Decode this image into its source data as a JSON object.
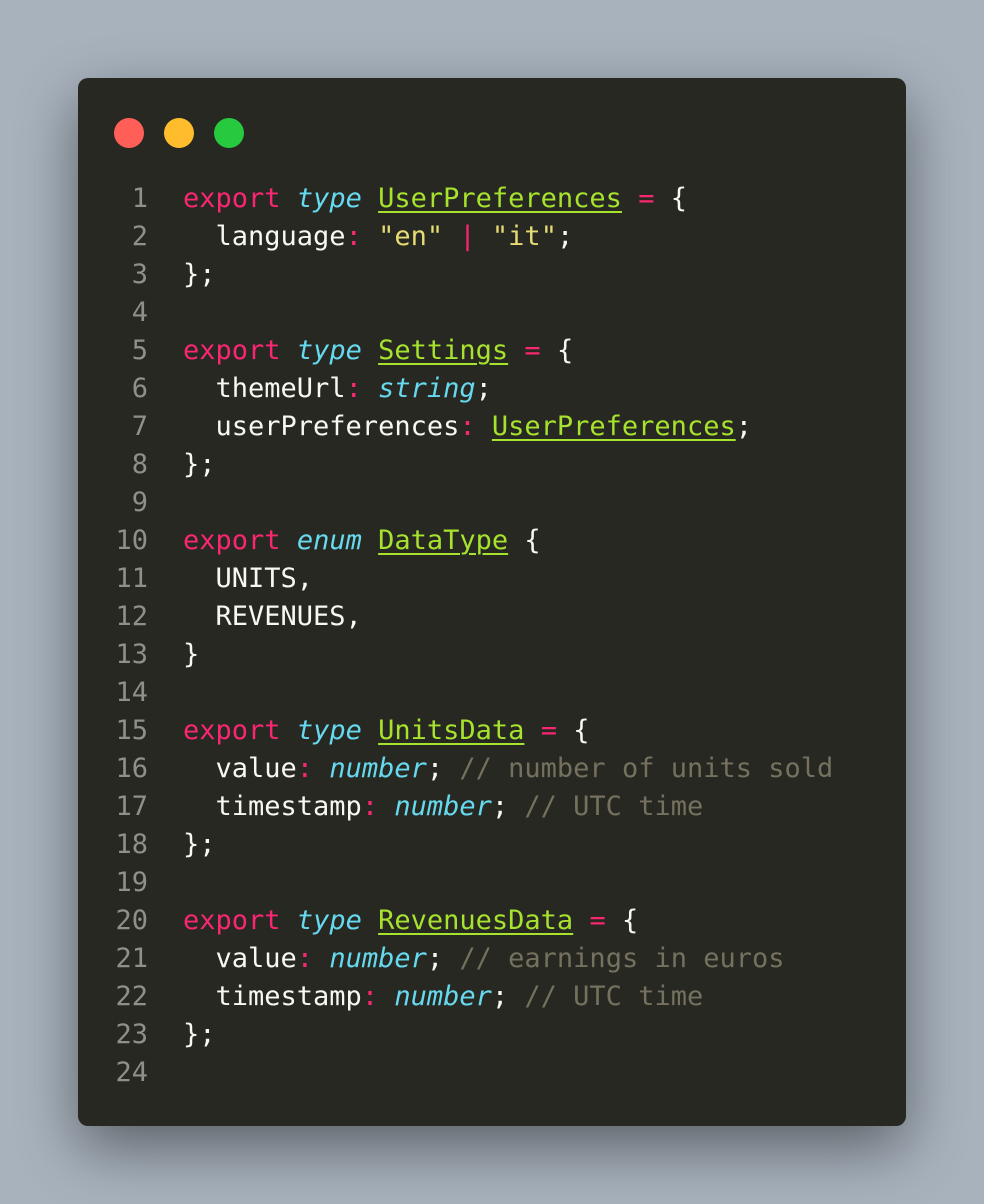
{
  "window": {
    "buttons": {
      "close_color": "#ff5f56",
      "minimize_color": "#ffbd2e",
      "maximize_color": "#27c93f"
    }
  },
  "editor": {
    "language": "TypeScript",
    "theme_colors": {
      "background": "#272822",
      "keyword": "#f92672",
      "storage": "#66d9ef",
      "type": "#a6e22e",
      "string": "#e6db74",
      "comment": "#75715e",
      "text": "#f8f8f2",
      "line_number": "#8f908a"
    },
    "lines": [
      {
        "n": "1",
        "tokens": [
          {
            "t": "export",
            "k": "keyword"
          },
          {
            "t": " ",
            "k": "text"
          },
          {
            "t": "type",
            "k": "storage"
          },
          {
            "t": " ",
            "k": "text"
          },
          {
            "t": "UserPreferences",
            "k": "type"
          },
          {
            "t": " ",
            "k": "text"
          },
          {
            "t": "=",
            "k": "operator"
          },
          {
            "t": " {",
            "k": "punct"
          }
        ]
      },
      {
        "n": "2",
        "tokens": [
          {
            "t": "  language",
            "k": "prop"
          },
          {
            "t": ":",
            "k": "operator"
          },
          {
            "t": " ",
            "k": "text"
          },
          {
            "t": "\"en\"",
            "k": "string"
          },
          {
            "t": " ",
            "k": "text"
          },
          {
            "t": "|",
            "k": "operator"
          },
          {
            "t": " ",
            "k": "text"
          },
          {
            "t": "\"it\"",
            "k": "string"
          },
          {
            "t": ";",
            "k": "punct"
          }
        ]
      },
      {
        "n": "3",
        "tokens": [
          {
            "t": "};",
            "k": "punct"
          }
        ]
      },
      {
        "n": "4",
        "tokens": []
      },
      {
        "n": "5",
        "tokens": [
          {
            "t": "export",
            "k": "keyword"
          },
          {
            "t": " ",
            "k": "text"
          },
          {
            "t": "type",
            "k": "storage"
          },
          {
            "t": " ",
            "k": "text"
          },
          {
            "t": "Settings",
            "k": "type"
          },
          {
            "t": " ",
            "k": "text"
          },
          {
            "t": "=",
            "k": "operator"
          },
          {
            "t": " {",
            "k": "punct"
          }
        ]
      },
      {
        "n": "6",
        "tokens": [
          {
            "t": "  themeUrl",
            "k": "prop"
          },
          {
            "t": ":",
            "k": "operator"
          },
          {
            "t": " ",
            "k": "text"
          },
          {
            "t": "string",
            "k": "storage"
          },
          {
            "t": ";",
            "k": "punct"
          }
        ]
      },
      {
        "n": "7",
        "tokens": [
          {
            "t": "  userPreferences",
            "k": "prop"
          },
          {
            "t": ":",
            "k": "operator"
          },
          {
            "t": " ",
            "k": "text"
          },
          {
            "t": "UserPreferences",
            "k": "type"
          },
          {
            "t": ";",
            "k": "punct"
          }
        ]
      },
      {
        "n": "8",
        "tokens": [
          {
            "t": "};",
            "k": "punct"
          }
        ]
      },
      {
        "n": "9",
        "tokens": []
      },
      {
        "n": "10",
        "tokens": [
          {
            "t": "export",
            "k": "keyword"
          },
          {
            "t": " ",
            "k": "text"
          },
          {
            "t": "enum",
            "k": "storage"
          },
          {
            "t": " ",
            "k": "text"
          },
          {
            "t": "DataType",
            "k": "type"
          },
          {
            "t": " {",
            "k": "punct"
          }
        ]
      },
      {
        "n": "11",
        "tokens": [
          {
            "t": "  UNITS,",
            "k": "text"
          }
        ]
      },
      {
        "n": "12",
        "tokens": [
          {
            "t": "  REVENUES,",
            "k": "text"
          }
        ]
      },
      {
        "n": "13",
        "tokens": [
          {
            "t": "}",
            "k": "punct"
          }
        ]
      },
      {
        "n": "14",
        "tokens": []
      },
      {
        "n": "15",
        "tokens": [
          {
            "t": "export",
            "k": "keyword"
          },
          {
            "t": " ",
            "k": "text"
          },
          {
            "t": "type",
            "k": "storage"
          },
          {
            "t": " ",
            "k": "text"
          },
          {
            "t": "UnitsData",
            "k": "type"
          },
          {
            "t": " ",
            "k": "text"
          },
          {
            "t": "=",
            "k": "operator"
          },
          {
            "t": " {",
            "k": "punct"
          }
        ]
      },
      {
        "n": "16",
        "tokens": [
          {
            "t": "  value",
            "k": "prop"
          },
          {
            "t": ":",
            "k": "operator"
          },
          {
            "t": " ",
            "k": "text"
          },
          {
            "t": "number",
            "k": "storage"
          },
          {
            "t": "; ",
            "k": "punct"
          },
          {
            "t": "// number of units sold",
            "k": "comment"
          }
        ]
      },
      {
        "n": "17",
        "tokens": [
          {
            "t": "  timestamp",
            "k": "prop"
          },
          {
            "t": ":",
            "k": "operator"
          },
          {
            "t": " ",
            "k": "text"
          },
          {
            "t": "number",
            "k": "storage"
          },
          {
            "t": "; ",
            "k": "punct"
          },
          {
            "t": "// UTC time",
            "k": "comment"
          }
        ]
      },
      {
        "n": "18",
        "tokens": [
          {
            "t": "};",
            "k": "punct"
          }
        ]
      },
      {
        "n": "19",
        "tokens": []
      },
      {
        "n": "20",
        "tokens": [
          {
            "t": "export",
            "k": "keyword"
          },
          {
            "t": " ",
            "k": "text"
          },
          {
            "t": "type",
            "k": "storage"
          },
          {
            "t": " ",
            "k": "text"
          },
          {
            "t": "RevenuesData",
            "k": "type"
          },
          {
            "t": " ",
            "k": "text"
          },
          {
            "t": "=",
            "k": "operator"
          },
          {
            "t": " {",
            "k": "punct"
          }
        ]
      },
      {
        "n": "21",
        "tokens": [
          {
            "t": "  value",
            "k": "prop"
          },
          {
            "t": ":",
            "k": "operator"
          },
          {
            "t": " ",
            "k": "text"
          },
          {
            "t": "number",
            "k": "storage"
          },
          {
            "t": "; ",
            "k": "punct"
          },
          {
            "t": "// earnings in euros",
            "k": "comment"
          }
        ]
      },
      {
        "n": "22",
        "tokens": [
          {
            "t": "  timestamp",
            "k": "prop"
          },
          {
            "t": ":",
            "k": "operator"
          },
          {
            "t": " ",
            "k": "text"
          },
          {
            "t": "number",
            "k": "storage"
          },
          {
            "t": "; ",
            "k": "punct"
          },
          {
            "t": "// UTC time",
            "k": "comment"
          }
        ]
      },
      {
        "n": "23",
        "tokens": [
          {
            "t": "};",
            "k": "punct"
          }
        ]
      },
      {
        "n": "24",
        "tokens": []
      }
    ]
  }
}
